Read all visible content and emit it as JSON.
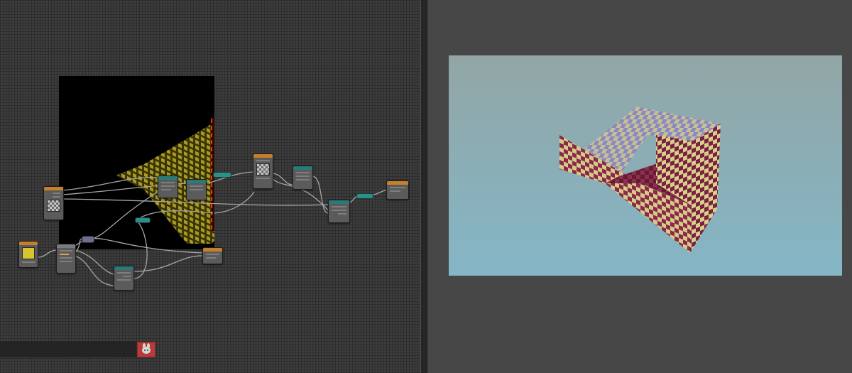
{
  "app": {
    "left_panel": "node-editor",
    "right_panel": "render-viewer"
  },
  "colors": {
    "node_editor_bg": "#3c3c3c",
    "viewer_bg": "#474747",
    "backdrop_bg": "#000000",
    "node_body": "#5b5b5b",
    "node_header_input": "#c6802b",
    "node_header_converter": "#2a7a78",
    "link": "#a6a6a6",
    "checker_red": "#ff3300",
    "checker_olive": "#a89a2a",
    "sky_top": "#92a6a6",
    "sky_bottom": "#84b6c6"
  },
  "icons": {
    "mascot_thumbnail": "mascot-thumbnail-icon"
  }
}
